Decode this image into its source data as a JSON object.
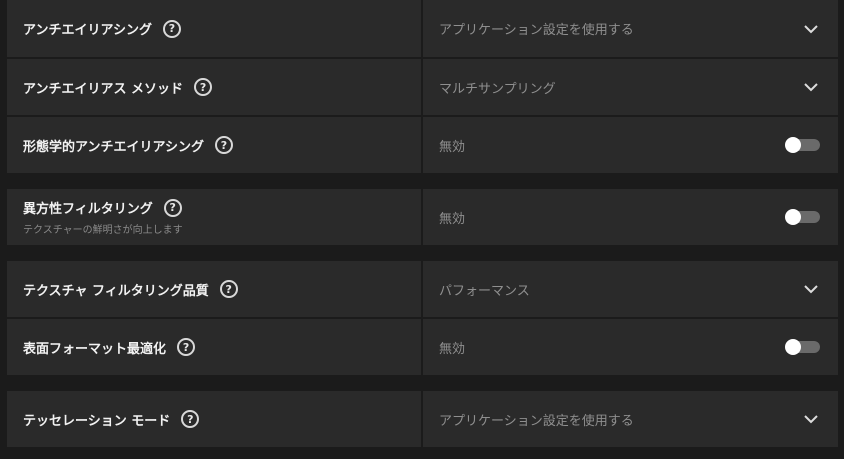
{
  "settings": [
    {
      "label": "アンチエイリアシング",
      "control": "dropdown",
      "value": "アプリケーション設定を使用する"
    },
    {
      "label": "アンチエイリアス メソッド",
      "control": "dropdown",
      "value": "マルチサンプリング"
    },
    {
      "label": "形態学的アンチエイリアシング",
      "control": "toggle",
      "value": "無効",
      "enabled": false
    },
    {
      "label": "異方性フィルタリング",
      "sublabel": "テクスチャーの鮮明さが向上します",
      "control": "toggle",
      "value": "無効",
      "enabled": false
    },
    {
      "label": "テクスチャ フィルタリング品質",
      "control": "dropdown",
      "value": "パフォーマンス"
    },
    {
      "label": "表面フォーマット最適化",
      "control": "toggle",
      "value": "無効",
      "enabled": false
    },
    {
      "label": "テッセレーション モード",
      "control": "dropdown",
      "value": "アプリケーション設定を使用する"
    }
  ],
  "icons": {
    "help": "help-icon",
    "dropdown": "chevron-down-icon",
    "toggle": "toggle-switch"
  },
  "colors": {
    "background": "#1b1b1b",
    "panel": "#2a2a2a",
    "label": "#f2f2f2",
    "value": "#8f8f8f",
    "toggle_track": "#6a6a6a",
    "toggle_knob": "#ffffff"
  }
}
